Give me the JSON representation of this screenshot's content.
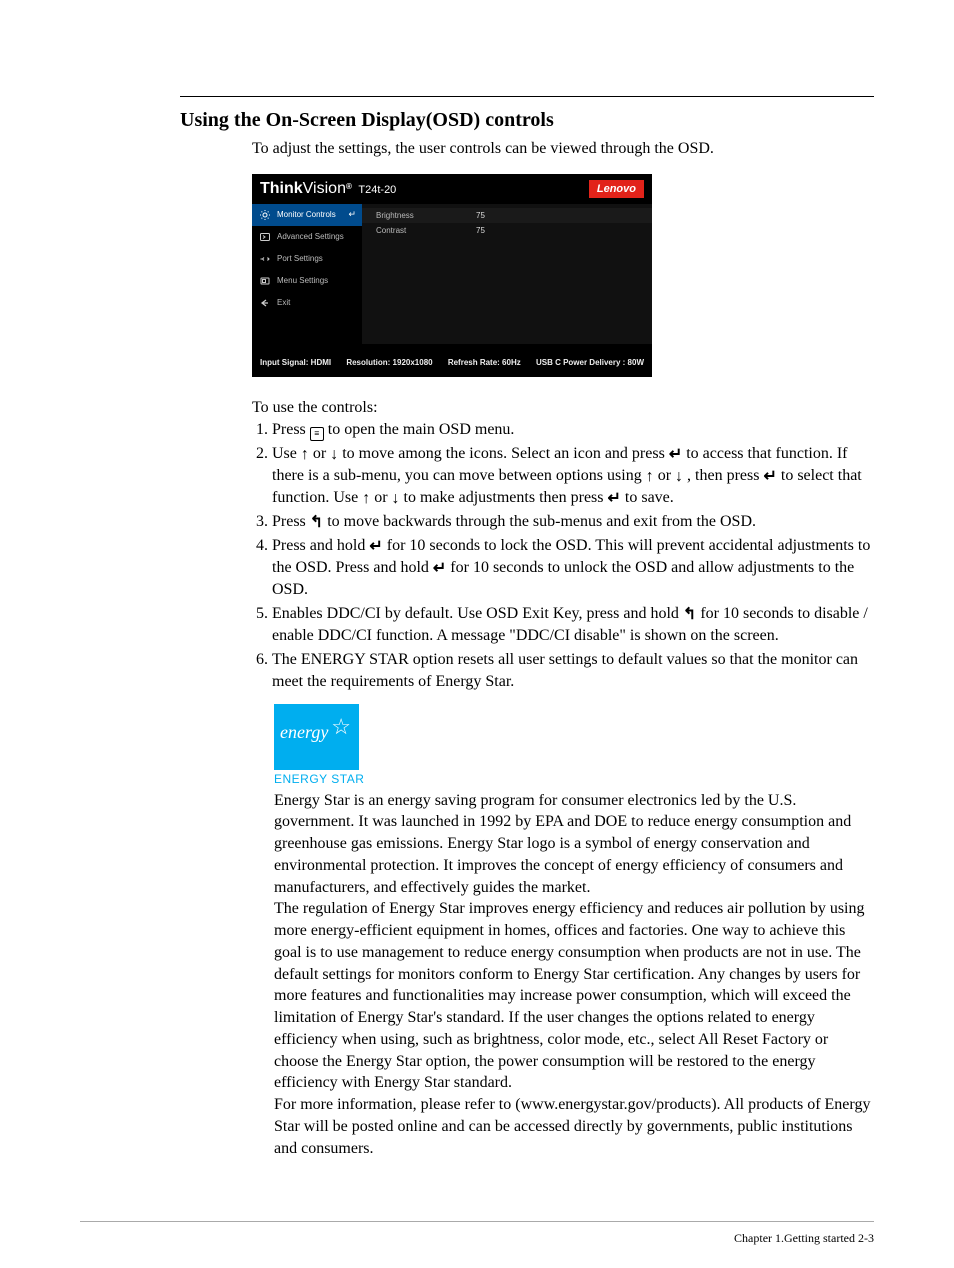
{
  "title": "Using the On-Screen Display(OSD) controls",
  "intro": "To adjust the settings, the user controls can be viewed through the OSD.",
  "osd": {
    "brand_html": "ThinkVision",
    "brand_sub": "®",
    "model": "T24t-20",
    "badge": "Lenovo",
    "menu": [
      {
        "name": "monitor-controls",
        "label": "Monitor Controls",
        "active": true
      },
      {
        "name": "advanced-settings",
        "label": "Advanced Settings",
        "active": false
      },
      {
        "name": "port-settings",
        "label": "Port Settings",
        "active": false
      },
      {
        "name": "menu-settings",
        "label": "Menu Settings",
        "active": false
      },
      {
        "name": "exit",
        "label": "Exit",
        "active": false
      }
    ],
    "rows": [
      {
        "k": "Brightness",
        "v": "75",
        "sel": true
      },
      {
        "k": "Contrast",
        "v": "75",
        "sel": false
      }
    ],
    "status": {
      "input": "Input Signal: HDMI",
      "res": "Resolution: 1920x1080",
      "rate": "Refresh Rate: 60Hz",
      "pd": "USB C Power Delivery : 80W"
    }
  },
  "lead": "To use the controls:",
  "steps": {
    "s1a": "Press ",
    "s1b": " to open the main OSD menu.",
    "s2a": "Use ",
    "s2b": " or ",
    "s2c": " to move among the icons. Select an icon and press ",
    "s2d": " to access that function. If there is a sub-menu, you can move between options using ",
    "s2e": " or ",
    "s2f": " ,   then press ",
    "s2g": " to select that function. Use ",
    "s2h": " or ",
    "s2i": " to make adjustments then press ",
    "s2j": " to save.",
    "s3a": "Press ",
    "s3b": " to move backwards through the sub-menus and exit from the OSD.",
    "s4a": "Press and hold ",
    "s4b": " for 10 seconds to lock the OSD. This will prevent accidental adjustments to the OSD. Press and hold  ",
    "s4c": " for 10 seconds to unlock the OSD and allow adjustments to the OSD.",
    "s5a": "Enables DDC/CI by default. Use OSD Exit Key, press and hold ",
    "s5b": " for 10 seconds to disable / enable DDC/CI function. A message \"DDC/CI disable\" is shown on the screen.",
    "s6": "The ENERGY STAR option resets all user settings to default values so that the monitor can meet the requirements of Energy Star."
  },
  "energy": {
    "caption": "ENERGY STAR",
    "script": "energy",
    "p1": "Energy Star is an energy saving program for consumer electronics led by the U.S. government. It was launched in 1992 by EPA and DOE to reduce energy consumption and greenhouse gas emissions. Energy Star logo is a symbol of energy conservation and environmental protection. It improves the concept of energy efficiency of consumers and manufacturers, and effectively guides the market.",
    "p2": "The regulation of Energy Star improves energy efficiency and reduces air pollution by using more energy-efficient equipment in homes, offices and factories. One way to achieve this goal is to use management to reduce energy consumption when products are not in use. The default settings for monitors conform to Energy Star certification. Any changes by users for more features and functionalities may increase power consumption, which will exceed the limitation of Energy Star's standard. If the user changes the options related to energy efficiency when using, such as brightness, color mode, etc., select All Reset Factory or choose the Energy Star option, the power consumption will be restored to the energy efficiency with Energy Star standard.",
    "p3": "For more information, please refer to (www.energystar.gov/products). All products of Energy Star will be posted online and can be accessed directly by governments, public institutions and consumers."
  },
  "footer": "Chapter 1.Getting started  2-3"
}
